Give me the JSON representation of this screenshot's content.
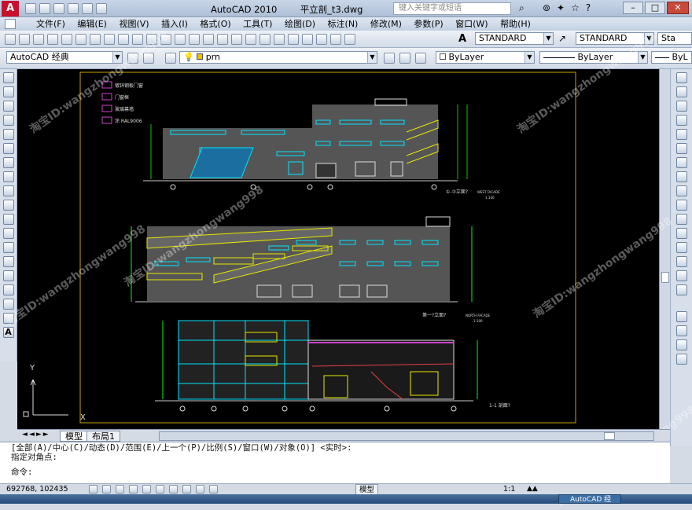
{
  "window": {
    "app_title": "AutoCAD 2010",
    "file_name": "平立剖_t3.dwg",
    "search_placeholder": "键入关键字或短语"
  },
  "menu": [
    "文件(F)",
    "编辑(E)",
    "视图(V)",
    "插入(I)",
    "格式(O)",
    "工具(T)",
    "绘图(D)",
    "标注(N)",
    "修改(M)",
    "参数(P)",
    "窗口(W)",
    "帮助(H)"
  ],
  "toolbar": {
    "text_style": "STANDARD",
    "dim_style": "STANDARD",
    "table_style_partial": "Sta",
    "workspace": "AutoCAD 经典",
    "layer": "prn",
    "color": "ByLayer",
    "linetype": "ByLayer",
    "lineweight_partial": "ByL"
  },
  "drawing": {
    "legend": [
      {
        "label": "镀锌钢板门窗",
        "color": "#cc44cc"
      },
      {
        "label": "门窗框",
        "color": "#cc44cc"
      },
      {
        "label": "玻璃幕墙",
        "color": "#cc44cc"
      },
      {
        "label": "涂 RAL9006",
        "color": "#cc44cc"
      }
    ],
    "titles": [
      {
        "text": "①-⑦立面?",
        "sub": "WEST FACADE",
        "scale": "1:100"
      },
      {
        "text": "第一?立面?",
        "sub": "NORTH FACADE",
        "scale": "1:100"
      },
      {
        "text": "1-1 剖面?",
        "sub": "",
        "scale": ""
      }
    ],
    "ucs_labels": {
      "y": "Y",
      "x": "X"
    }
  },
  "layout_tabs": [
    "模型",
    "布局1"
  ],
  "command_lines": [
    "[全部(A)/中心(C)/动态(D)/范围(E)/上一个(P)/比例(S)/窗口(W)/对象(O)] <实时>:",
    "指定对角点:",
    "命令:"
  ],
  "status": {
    "coords": "692768, 102435",
    "model": "模型",
    "scale": "1:1"
  },
  "taskbar": {
    "item": "AutoCAD 经"
  },
  "watermarks": [
    "淘宝ID:wangzhongwang998",
    "淘宝ID:wangzhongwang998",
    "淘宝ID:wangzhongwang998",
    "淘宝ID:wangzhongwang998",
    "淘宝ID:wangzhongwang998",
    "淘宝ID:wangzhongwang998"
  ]
}
